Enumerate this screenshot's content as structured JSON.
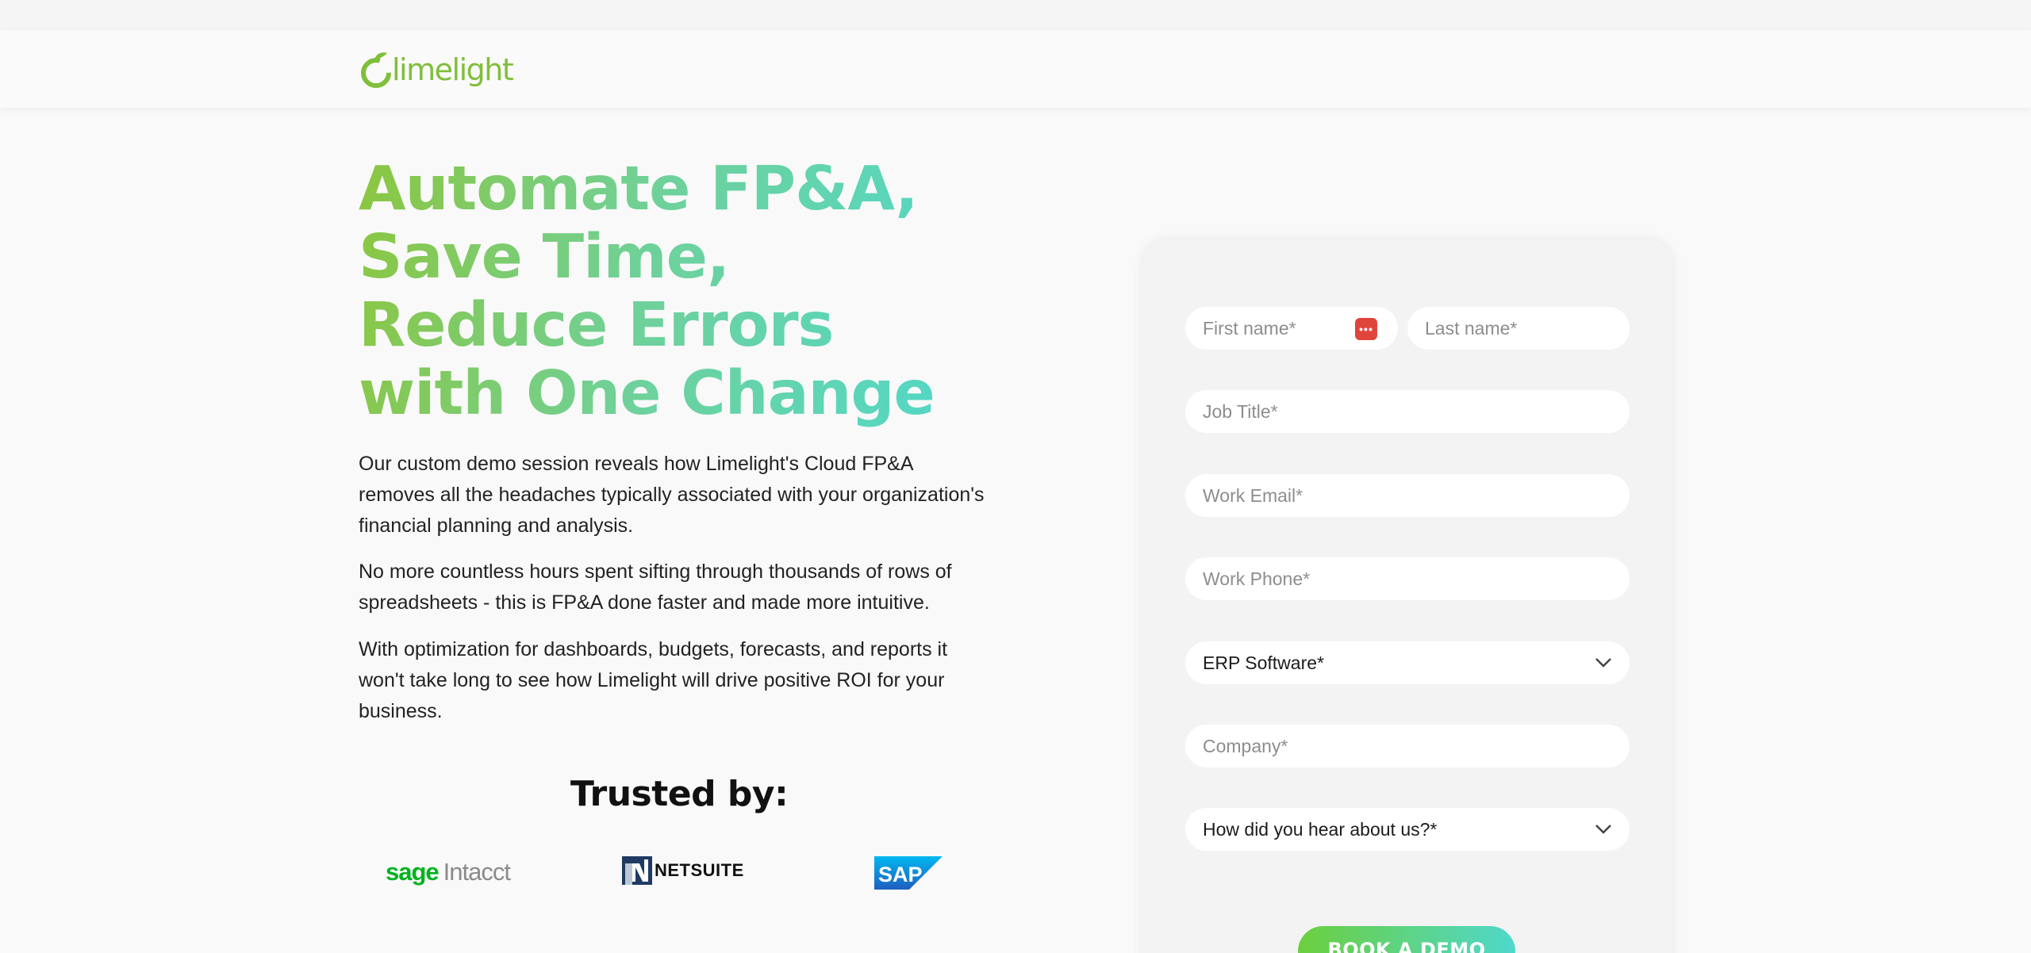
{
  "brand": {
    "name": "limelight",
    "accent": "#7fbf3a",
    "gradient_start": "#8cc63f",
    "gradient_end": "#4fd8cc"
  },
  "hero": {
    "title": "Automate FP&A, Save Time, Reduce Errors with One Change",
    "paragraphs": [
      "Our custom demo session reveals how Limelight's Cloud FP&A removes all the headaches typically associated with your organization's financial planning and analysis.",
      "No more countless hours spent sifting through thousands of rows of spreadsheets - this is FP&A done faster and made more intuitive.",
      "With optimization for dashboards, budgets, forecasts, and reports it won't take long to see how Limelight will drive positive ROI for your business."
    ]
  },
  "trusted": {
    "heading": "Trusted by:",
    "logos": {
      "sage_part1": "sage",
      "sage_part2": "Intacct",
      "netsuite": "NETSUITE",
      "sap": "SAP"
    }
  },
  "form": {
    "first_name_placeholder": "First name*",
    "last_name_placeholder": "Last name*",
    "job_title_placeholder": "Job Title*",
    "work_email_placeholder": "Work Email*",
    "work_phone_placeholder": "Work Phone*",
    "erp_select": "ERP Software*",
    "company_placeholder": "Company*",
    "hear_select": "How did you hear about us?*",
    "autofill_icon_text": "•••",
    "submit_label": "BOOK A DEMO"
  }
}
